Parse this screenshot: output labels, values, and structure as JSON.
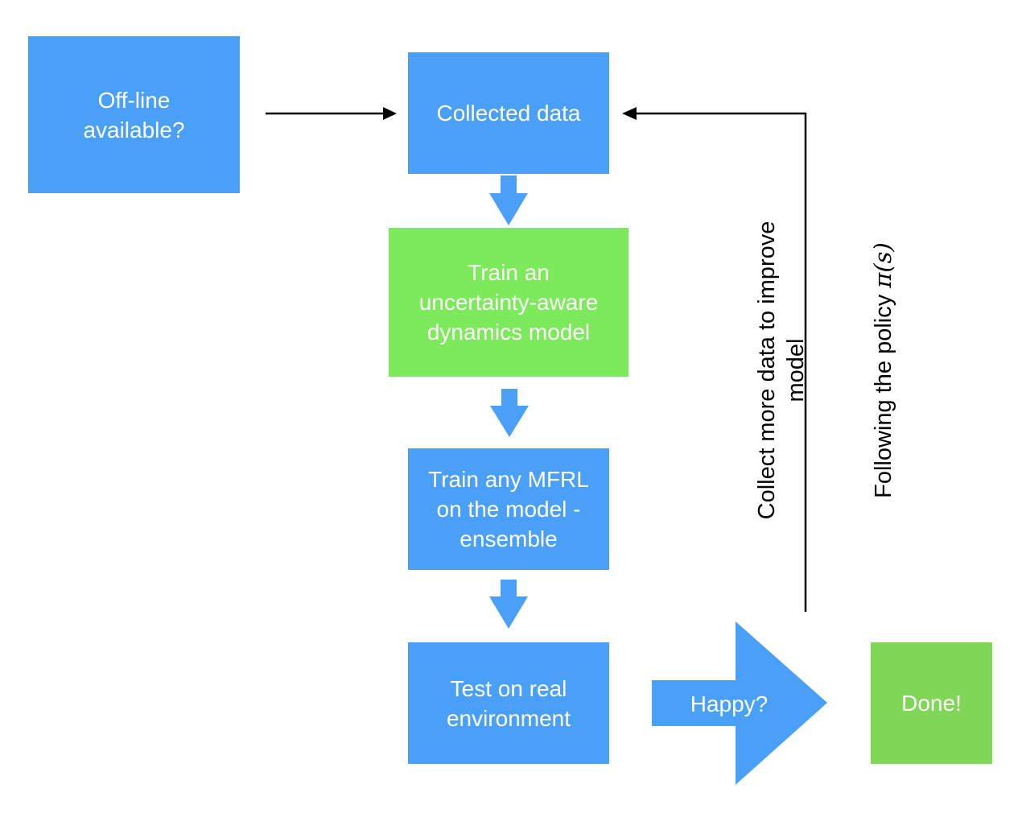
{
  "diagram": {
    "colors": {
      "process_blue": "#4aa0f7",
      "model_green": "#7cea5a",
      "done_green": "#80d656",
      "connector": "#000000",
      "text_on_box": "#ffffff"
    },
    "nodes": {
      "offline": {
        "label": "Off-line\navailable?"
      },
      "collected": {
        "label": "Collected data"
      },
      "train_model": {
        "label": "Train an\nuncertainty-aware\ndynamics model"
      },
      "train_mfrl": {
        "label": "Train any MFRL\non the model -\nensemble"
      },
      "test": {
        "label": "Test on real\nenvironment"
      },
      "happy": {
        "label": "Happy?"
      },
      "done": {
        "label": "Done!"
      }
    },
    "feedback_label": {
      "line1": "Collect more data to improve\nmodel",
      "line2_prefix": "Following the policy ",
      "line2_math": "π(s)"
    },
    "edges": [
      {
        "from": "offline",
        "to": "collected",
        "style": "line-arrow"
      },
      {
        "from": "collected",
        "to": "train_model",
        "style": "block-arrow"
      },
      {
        "from": "train_model",
        "to": "train_mfrl",
        "style": "block-arrow"
      },
      {
        "from": "train_mfrl",
        "to": "test",
        "style": "block-arrow"
      },
      {
        "from": "test",
        "to": "done",
        "style": "big-arrow",
        "label": "Happy?"
      },
      {
        "from": "happy",
        "to": "collected",
        "style": "elbow-line-arrow",
        "label": "Collect more data to improve model / Following the policy π(s)"
      }
    ]
  }
}
